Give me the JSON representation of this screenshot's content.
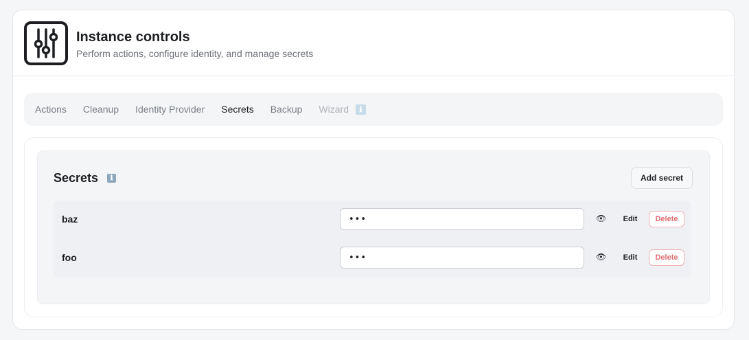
{
  "header": {
    "title": "Instance controls",
    "subtitle": "Perform actions, configure identity, and manage secrets",
    "logo_icon": "sliders-icon"
  },
  "tabs": [
    {
      "label": "Actions",
      "state": "normal"
    },
    {
      "label": "Cleanup",
      "state": "normal"
    },
    {
      "label": "Identity Provider",
      "state": "normal"
    },
    {
      "label": "Secrets",
      "state": "active"
    },
    {
      "label": "Backup",
      "state": "normal"
    },
    {
      "label": "Wizard",
      "state": "disabled",
      "info": "ℹ"
    }
  ],
  "secrets": {
    "title": "Secrets",
    "info": "ℹ",
    "add_label": "Add secret",
    "rows": [
      {
        "name": "baz",
        "value": "•••",
        "reveal_icon": "👁",
        "edit_label": "Edit",
        "delete_label": "Delete"
      },
      {
        "name": "foo",
        "value": "•••",
        "reveal_icon": "👁",
        "edit_label": "Edit",
        "delete_label": "Delete"
      }
    ]
  },
  "colors": {
    "accent_delete": "#e06c71",
    "info_badge": "#8fa7ba"
  }
}
